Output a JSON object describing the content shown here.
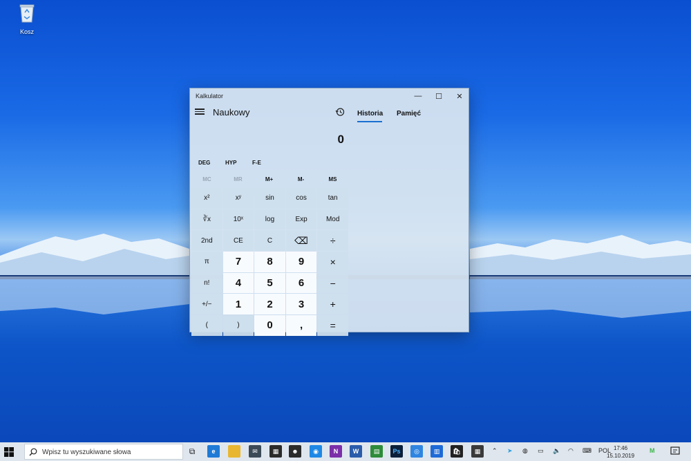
{
  "desktop": {
    "recycle_bin_label": "Kosz"
  },
  "window": {
    "title": "Kalkulator",
    "mode": "Naukowy",
    "tabs": {
      "history": "Historia",
      "memory": "Pamięć"
    },
    "display_value": "0",
    "angle_buttons": [
      "DEG",
      "HYP",
      "F-E"
    ],
    "memory_buttons": [
      {
        "label": "MC",
        "enabled": false
      },
      {
        "label": "MR",
        "enabled": false
      },
      {
        "label": "M+",
        "enabled": true
      },
      {
        "label": "M-",
        "enabled": true
      },
      {
        "label": "MS",
        "enabled": true
      }
    ],
    "keys": [
      [
        "x²",
        "xʸ",
        "sin",
        "cos",
        "tan"
      ],
      [
        "∛x",
        "10ˣ",
        "log",
        "Exp",
        "Mod"
      ],
      [
        "2nd",
        "CE",
        "C",
        "⌫",
        "÷"
      ],
      [
        "π",
        "7",
        "8",
        "9",
        "×"
      ],
      [
        "n!",
        "4",
        "5",
        "6",
        "−"
      ],
      [
        "+/−",
        "1",
        "2",
        "3",
        "+"
      ],
      [
        "(",
        ")",
        "0",
        ",",
        "="
      ]
    ],
    "controls": {
      "minimize": "—",
      "maximize": "☐",
      "close": "✕"
    }
  },
  "taskbar": {
    "search_placeholder": "Wpisz tu wyszukiwane słowa",
    "language": "POL",
    "time": "17:46",
    "date": "15.10.2019"
  },
  "colors": {
    "accent": "#1a6fd0",
    "window_bg": "#dae6f1",
    "taskbar_bg": "#dfe6ee"
  }
}
